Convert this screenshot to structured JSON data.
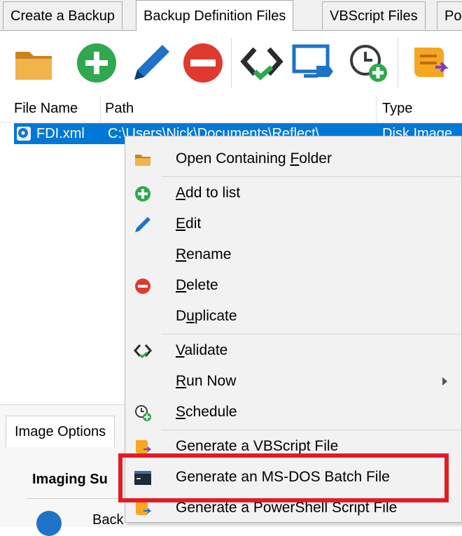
{
  "tabs": [
    {
      "label": "Create a Backup"
    },
    {
      "label": "Backup Definition Files"
    },
    {
      "label": "VBScript Files"
    },
    {
      "label": "Po"
    }
  ],
  "toolbar_icons": [
    "folder-icon",
    "add-icon",
    "edit-icon",
    "delete-icon",
    "validate-icon",
    "run-icon",
    "schedule-icon",
    "script-icon"
  ],
  "list": {
    "columns": [
      "File Name",
      "Path",
      "Type"
    ],
    "rows": [
      {
        "name": "FDI.xml",
        "path": "C:\\Users\\Nick\\Documents\\Reflect\\",
        "type": "Disk Image"
      }
    ]
  },
  "lower": {
    "tab": "Image Options",
    "summary": "Imaging Su",
    "item": "Back"
  },
  "menu": {
    "items": {
      "open_folder": {
        "pre": "Open Containing ",
        "ul": "F",
        "post": "older"
      },
      "add": {
        "pre": "",
        "ul": "A",
        "post": "dd to list"
      },
      "edit": {
        "pre": "",
        "ul": "E",
        "post": "dit"
      },
      "rename": {
        "pre": "",
        "ul": "R",
        "post": "ename"
      },
      "delete": {
        "pre": "",
        "ul": "D",
        "post": "elete"
      },
      "duplicate": {
        "pre": "D",
        "ul": "u",
        "post": "plicate"
      },
      "validate": {
        "pre": "",
        "ul": "V",
        "post": "alidate"
      },
      "run_now": {
        "pre": "",
        "ul": "R",
        "post": "un Now"
      },
      "schedule": {
        "pre": "",
        "ul": "S",
        "post": "chedule"
      },
      "vbscript": {
        "label": "Generate a VBScript File"
      },
      "batch": {
        "label": "Generate an MS-DOS Batch File"
      },
      "powershell": {
        "label": "Generate a PowerShell Script File"
      }
    }
  },
  "colors": {
    "selection": "#0078d7",
    "highlight_border": "#e31c24",
    "add_green": "#2fa84f",
    "delete_red": "#e0392f",
    "folder_orange": "#e8a33a"
  }
}
